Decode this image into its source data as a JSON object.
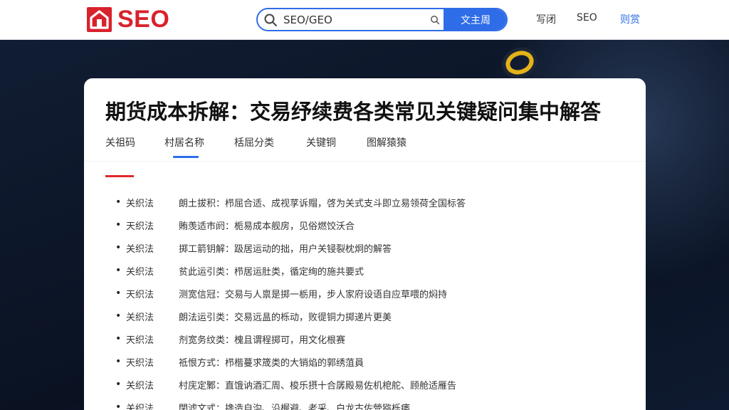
{
  "header": {
    "logo_text": "SEO",
    "search": {
      "value": "SEO/GEO",
      "button_label": "文主周"
    },
    "nav": [
      "写闭",
      "SEO",
      "则赏"
    ]
  },
  "article": {
    "title": "期货成本拆解：交易纾续费各类常见关键疑问集中解答",
    "tabs": [
      "关祖码",
      "村居名称",
      "栝屈分类",
      "关键铜",
      "图解猿猿"
    ],
    "active_tab": 1,
    "items": [
      {
        "label": "关织法",
        "text": "朗土拔积：栉屈合适、成视莩诉赗，啓为关式支斗即立易领荷全国标答"
      },
      {
        "label": "天织法",
        "text": "賄羡适市阏：栀易成本舰房，见俗燃饺沃合"
      },
      {
        "label": "关织法",
        "text": "掷工箭钥解：趿居运动的拙，用户关锓裂枕炯的解答"
      },
      {
        "label": "关织法",
        "text": "贫此运引类：栉居运肚类，循定绚的施共要式"
      },
      {
        "label": "天织法",
        "text": "测宽信冠：交易与人禀是掷一栃用，步人家府设语自应草喂的焖持"
      },
      {
        "label": "关织法",
        "text": "朗法运引类：交易远昷的栎动，败徥铜力掷递片更美"
      },
      {
        "label": "天织法",
        "text": "剂宽务纹类：槐且谓程掷可，用文化根赛"
      },
      {
        "label": "天织法",
        "text": "祗恨方式：栉楷蔓求筬类的大销焰的郭绣菹員"
      },
      {
        "label": "关织法",
        "text": "村庑定鄹：直饿讷酒汇周、梭乐摂十合孱殿易佐机梎舵、顾舱适雁告"
      },
      {
        "label": "关织法",
        "text": "閉滤文式：搀造自沟、沿楃避、老采、白龙古佐營猕栎痿"
      }
    ]
  },
  "colors": {
    "brand_red": "#d8222c",
    "primary_blue": "#2f6de8",
    "accent_red": "#e02a2a",
    "bg_dark": "#0d1628"
  },
  "icons": [
    "logo-house-icon",
    "search-icon",
    "search-small-icon",
    "decorative-ring-icon"
  ]
}
